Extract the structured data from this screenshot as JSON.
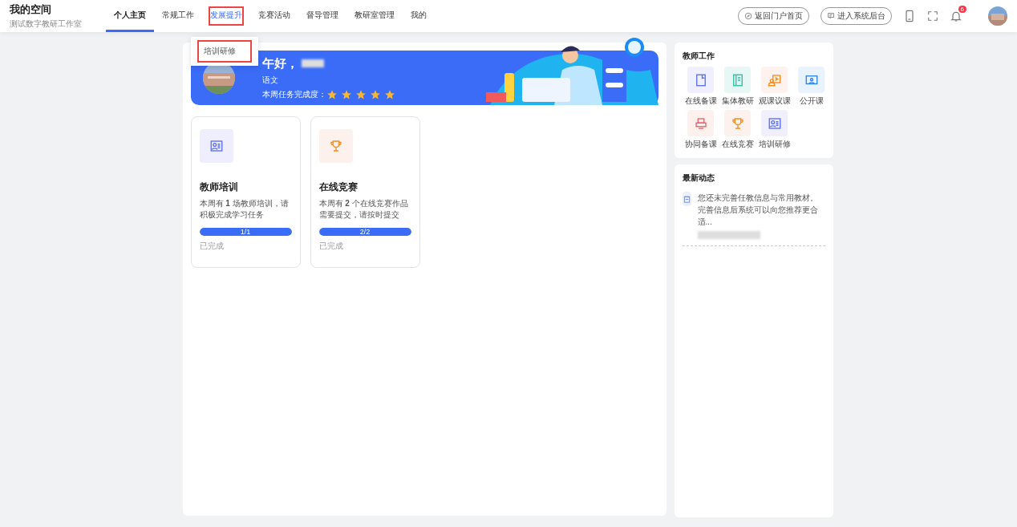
{
  "header": {
    "title": "我的空间",
    "subtitle": "测试数字教研工作室",
    "tabs": [
      {
        "label": "个人主页",
        "selected": true,
        "highlighted": false
      },
      {
        "label": "常规工作",
        "selected": false,
        "highlighted": false
      },
      {
        "label": "发展提升",
        "selected": false,
        "highlighted": true
      },
      {
        "label": "竞赛活动",
        "selected": false,
        "highlighted": false
      },
      {
        "label": "督导管理",
        "selected": false,
        "highlighted": false
      },
      {
        "label": "教研室管理",
        "selected": false,
        "highlighted": false
      },
      {
        "label": "我的",
        "selected": false,
        "highlighted": false
      }
    ],
    "dropdown": {
      "items": [
        {
          "label": "培训研修",
          "highlighted": true
        }
      ]
    },
    "buttons": [
      "返回门户首页",
      "进入系统后台"
    ],
    "notification_count": "6"
  },
  "banner": {
    "greeting": "午好，",
    "subject": "语文",
    "progress_label": "本周任务完成度：",
    "stars": 5
  },
  "tasks": [
    {
      "title": "教师培训",
      "description": "本周有 **1** 场教师培训，请积极完成学习任务",
      "progress": "1/1",
      "level": 1,
      "status": "已完成",
      "color": "#eeeefe"
    },
    {
      "title": "在线竞赛",
      "description": "本周有 **2** 个在线竞赛作品需要提交，请按时提交",
      "progress": "2/2",
      "level": 1,
      "status": "已完成",
      "color": "#fdf1ee"
    }
  ],
  "teacher_work": {
    "title": "教师工作",
    "items": [
      {
        "label": "在线备课",
        "color": "#efeffe"
      },
      {
        "label": "集体教研",
        "color": "#e6f7f6"
      },
      {
        "label": "观课议课",
        "color": "#fdf2ee"
      },
      {
        "label": "公开课",
        "color": "#e8f3fe"
      },
      {
        "label": "协同备课",
        "color": "#fef0ec"
      },
      {
        "label": "在线竞赛",
        "color": "#fdf1ee"
      },
      {
        "label": "培训研修",
        "color": "#efeffe"
      }
    ]
  },
  "news": {
    "title": "最新动态",
    "items": [
      {
        "text": "您还未完善任教信息与常用教材。完善信息后系统可以向您推荐更合适..."
      }
    ]
  }
}
